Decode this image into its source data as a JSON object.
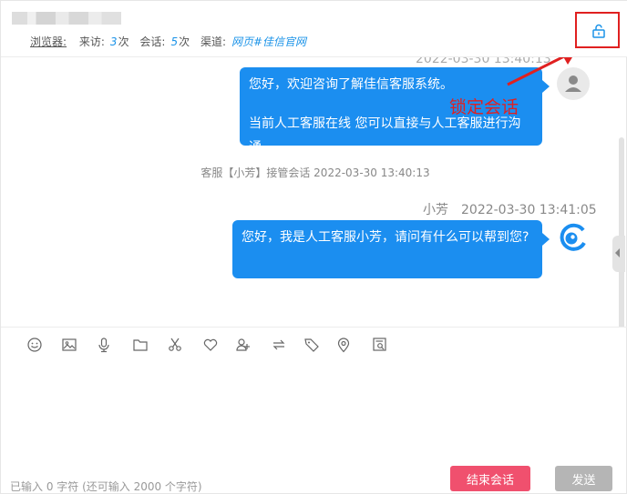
{
  "header": {
    "browser_label": "浏览器:",
    "visit_label": "来访:",
    "visit_count": "3",
    "visit_unit": "次",
    "session_label": "会话:",
    "session_count": "5",
    "session_unit": "次",
    "channel_label": "渠道:",
    "channel_value": "网页#佳信官网"
  },
  "chat": {
    "top_timestamp_fragment": "2022-03-30 13:40:13",
    "messages": [
      {
        "line1": "您好，欢迎咨询了解佳信客服系统。",
        "line2": "当前人工客服在线 您可以直接与人工客服进行沟通"
      },
      {
        "sender": "小芳",
        "time": "2022-03-30 13:41:05",
        "text": "您好，我是人工客服小芳，请问有什么可以帮到您?"
      }
    ],
    "system_note": "客服【小芳】接管会话  2022-03-30 13:40:13"
  },
  "annotation": {
    "label": "锁定会话",
    "color": "#e02020"
  },
  "toolbar": {
    "icons": [
      "emoji-icon",
      "image-icon",
      "microphone-icon",
      "folder-icon",
      "scissors-icon",
      "heart-icon",
      "add-user-icon",
      "transfer-icon",
      "tag-icon",
      "location-icon",
      "search-record-icon"
    ]
  },
  "footer": {
    "char_count": "已输入 0 字符  (还可输入 2000 个字符)",
    "end_button": "结束会话",
    "send_button": "发送"
  },
  "colors": {
    "bubble": "#1b8ef0",
    "accent": "#1b93e8",
    "end_button": "#f0506e",
    "send_button": "#b5b5b5"
  }
}
